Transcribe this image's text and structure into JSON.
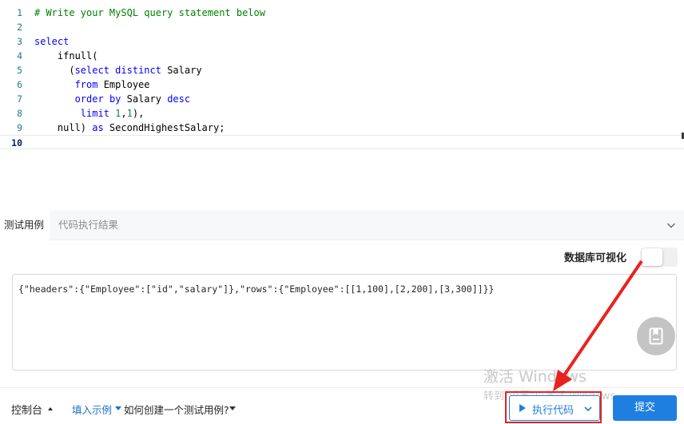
{
  "editor": {
    "active_line": 10,
    "lines": [
      {
        "n": "1",
        "tokens": [
          [
            "cm",
            "# Write your MySQL query statement below"
          ]
        ]
      },
      {
        "n": "2",
        "tokens": []
      },
      {
        "n": "3",
        "tokens": [
          [
            "kw",
            "select"
          ]
        ]
      },
      {
        "n": "4",
        "tokens": [
          [
            "plain",
            "    ifnull("
          ]
        ]
      },
      {
        "n": "5",
        "tokens": [
          [
            "plain",
            "      ("
          ],
          [
            "kw",
            "select"
          ],
          [
            "plain",
            " "
          ],
          [
            "kw",
            "distinct"
          ],
          [
            "plain",
            " Salary"
          ]
        ]
      },
      {
        "n": "6",
        "tokens": [
          [
            "plain",
            "       "
          ],
          [
            "kw",
            "from"
          ],
          [
            "plain",
            " Employee"
          ]
        ]
      },
      {
        "n": "7",
        "tokens": [
          [
            "plain",
            "       "
          ],
          [
            "kw",
            "order"
          ],
          [
            "plain",
            " "
          ],
          [
            "kw",
            "by"
          ],
          [
            "plain",
            " Salary "
          ],
          [
            "kw",
            "desc"
          ]
        ]
      },
      {
        "n": "8",
        "tokens": [
          [
            "plain",
            "        "
          ],
          [
            "kw",
            "limit"
          ],
          [
            "plain",
            " "
          ],
          [
            "num",
            "1"
          ],
          [
            "plain",
            ","
          ],
          [
            "num",
            "1"
          ],
          [
            "plain",
            "),"
          ]
        ]
      },
      {
        "n": "9",
        "tokens": [
          [
            "plain",
            "    null) "
          ],
          [
            "kw",
            "as"
          ],
          [
            "plain",
            " SecondHighestSalary;"
          ]
        ]
      },
      {
        "n": "10",
        "tokens": []
      }
    ]
  },
  "tabs": {
    "testcase": "测试用例",
    "result": "代码执行结果"
  },
  "visualize": {
    "label": "数据库可视化",
    "enabled": false
  },
  "testcase": {
    "value": "{\"headers\":{\"Employee\":[\"id\",\"salary\"]},\"rows\":{\"Employee\":[[1,100],[2,200],[3,300]]}}"
  },
  "watermark": {
    "line1": "激活 Windows",
    "line2": "转到\"设置\"以激活 Windows。"
  },
  "footer": {
    "console": "控制台",
    "fill_example": "填入示例",
    "howto": "如何创建一个测试用例?",
    "run": "执行代码",
    "submit": "提交"
  },
  "colors": {
    "accent": "#1f7fe0",
    "annotation": "#e8231f"
  },
  "icons": {
    "collapse": "chevron-down-icon",
    "note": "bookmark-note-icon",
    "run": "play-icon"
  }
}
